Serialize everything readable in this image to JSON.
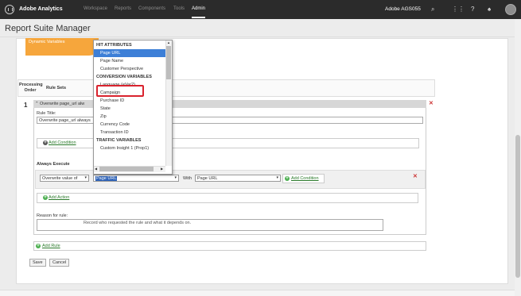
{
  "topbar": {
    "brand": "Adobe Analytics",
    "nav": [
      "Workspace",
      "Reports",
      "Components",
      "Tools",
      "Admin"
    ],
    "company": "Adobe AGS055",
    "icons": [
      "search-icon",
      "apps-grid-icon",
      "help-icon",
      "bell-icon",
      "avatar"
    ]
  },
  "page": {
    "title": "Report Suite Manager"
  },
  "banner": {
    "text": "Dynamic Variables"
  },
  "table": {
    "col_processing": "Processing Order",
    "col_rulesets": "Rule Sets"
  },
  "rule": {
    "number": "1",
    "header_label": "Overwrite page_url alw",
    "title_label": "Rule Title:",
    "title_value": "Overwrite page_url always",
    "add_condition": "Add Condition",
    "always_execute": "Always Execute",
    "action_select": "Overwrite value of",
    "action_target": "Page URL",
    "with_label": "With",
    "with_value": "Page URL",
    "add_condition_inline": "Add Condition",
    "add_action": "Add Action",
    "reason_label": "Reason for rule:",
    "reason_placeholder": "Record who requested the rule and what it depends on."
  },
  "add_rule": "Add Rule",
  "buttons": {
    "save": "Save",
    "cancel": "Cancel"
  },
  "dropdown": {
    "items": [
      {
        "label": "HIT ATTRIBUTES",
        "group": true
      },
      {
        "label": "Page URL",
        "selected": true
      },
      {
        "label": "Page Name"
      },
      {
        "label": "Customer Perspective"
      },
      {
        "label": "CONVERSION VARIABLES",
        "group": true
      },
      {
        "label": "Language (eVar2)",
        "highlighted": true
      },
      {
        "label": "Campaign"
      },
      {
        "label": "Purchase ID"
      },
      {
        "label": "State"
      },
      {
        "label": "Zip"
      },
      {
        "label": "Currency Code"
      },
      {
        "label": "Transaction ID"
      },
      {
        "label": "TRAFFIC VARIABLES",
        "group": true
      },
      {
        "label": "Custom Insight 1 (Prop1)"
      }
    ]
  },
  "colors": {
    "topbar": "#2b2b2b",
    "banner": "#f6a63c",
    "selected": "#3d7fd7",
    "highlight_box": "#d9232e",
    "link": "#2c7b2c"
  }
}
